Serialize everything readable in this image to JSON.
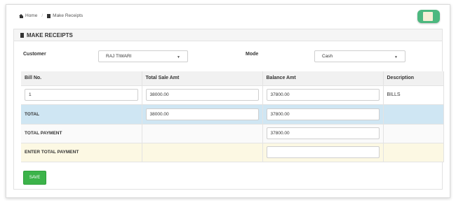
{
  "breadcrumb": {
    "home": "Home",
    "current": "Make Receipts"
  },
  "panel": {
    "title": "MAKE RECEIPTS"
  },
  "filters": {
    "customer_label": "Customer",
    "customer_value": "RAJ TIWARI",
    "mode_label": "Mode",
    "mode_value": "Cash"
  },
  "table": {
    "headers": [
      "Bill No.",
      "Total Sale Amt",
      "Balance Amt",
      "Description"
    ],
    "bill_row": {
      "bill_no": "1",
      "total_sale": "38000.00",
      "balance": "37800.00",
      "description": "BILLS"
    },
    "total_row": {
      "label": "TOTAL",
      "total_sale": "38000.00",
      "balance": "37800.00"
    },
    "payment_row": {
      "label": "TOTAL PAYMENT",
      "balance": "37800.00"
    },
    "enter_row": {
      "label": "ENTER TOTAL PAYMENT",
      "balance": ""
    }
  },
  "actions": {
    "save_label": "SAVE"
  },
  "colors": {
    "accent_green": "#3cb34a",
    "total_row_bg": "#cfe6f3",
    "enter_row_bg": "#fcf8e3"
  }
}
